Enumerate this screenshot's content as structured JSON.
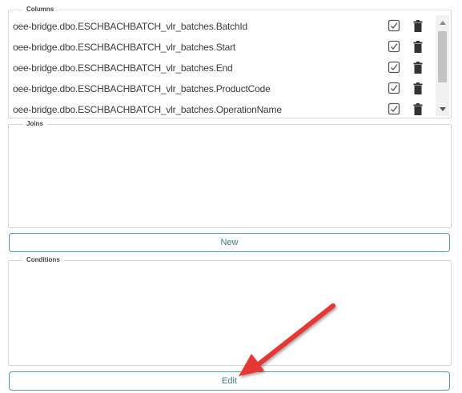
{
  "columns": {
    "legend": "Columns",
    "items": [
      {
        "name": "oee-bridge.dbo.ESCHBACHBATCH_vlr_batches.BatchId"
      },
      {
        "name": "oee-bridge.dbo.ESCHBACHBATCH_vlr_batches.Start"
      },
      {
        "name": "oee-bridge.dbo.ESCHBACHBATCH_vlr_batches.End"
      },
      {
        "name": "oee-bridge.dbo.ESCHBACHBATCH_vlr_batches.ProductCode"
      },
      {
        "name": "oee-bridge.dbo.ESCHBACHBATCH_vlr_batches.OperationName"
      }
    ],
    "row_icons": [
      "checkbox-edit-icon",
      "trash-icon"
    ]
  },
  "joins": {
    "legend": "Joins",
    "new_button_label": "New"
  },
  "conditions": {
    "legend": "Conditions",
    "edit_button_label": "Edit"
  },
  "annotation": {
    "type": "arrow",
    "color": "#e53935",
    "points_to": "edit-button"
  },
  "colors": {
    "button_border": "#5f9e97",
    "button_text": "#3f7f78",
    "group_border": "#d6d6d6",
    "scroll_thumb": "#c2c2c2"
  }
}
